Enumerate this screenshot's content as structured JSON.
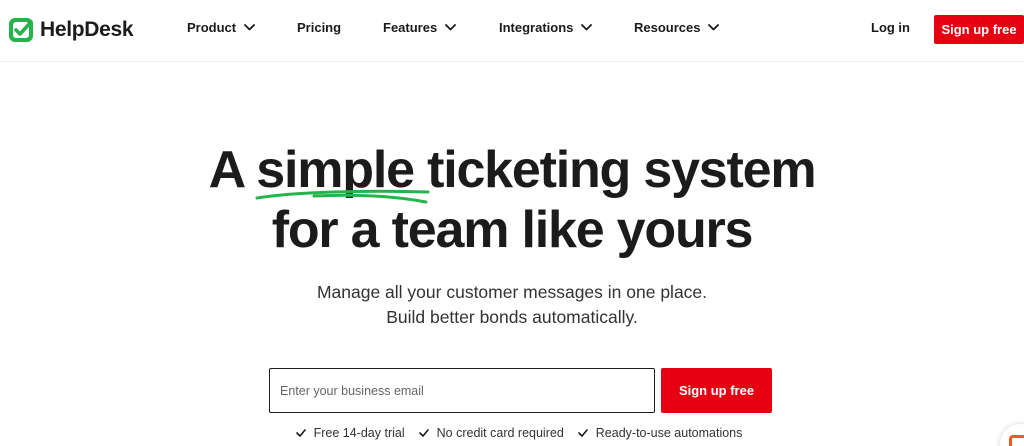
{
  "header": {
    "logo_text": "HelpDesk",
    "nav": [
      {
        "label": "Product",
        "has_dropdown": true
      },
      {
        "label": "Pricing",
        "has_dropdown": false
      },
      {
        "label": "Features",
        "has_dropdown": true
      },
      {
        "label": "Integrations",
        "has_dropdown": true
      },
      {
        "label": "Resources",
        "has_dropdown": true
      }
    ],
    "login_label": "Log in",
    "signup_label": "Sign up free"
  },
  "hero": {
    "title_line1_prefix": "A",
    "title_accent_word": "simple",
    "title_line1_suffix": "ticketing system",
    "title_line2": "for a team like yours",
    "subtitle_line1": "Manage all your customer messages in one place.",
    "subtitle_line2": "Build better bonds automatically."
  },
  "form": {
    "email_placeholder": "Enter your business email",
    "email_value": "",
    "signup_label": "Sign up free"
  },
  "features": [
    {
      "label": "Free 14-day trial",
      "icon": "check-icon"
    },
    {
      "label": "No credit card required",
      "icon": "check-icon"
    },
    {
      "label": "Ready-to-use automations",
      "icon": "check-icon"
    }
  ],
  "colors": {
    "brand_green": "#27b34b",
    "cta_red": "#e60012",
    "text_dark": "#1b1b1b",
    "chat_orange": "#f05a22"
  }
}
